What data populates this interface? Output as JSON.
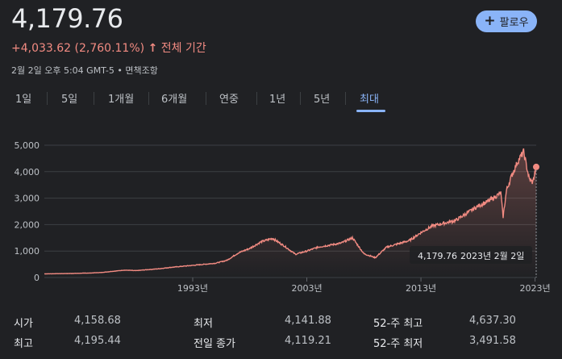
{
  "header": {
    "price": "4,179.76",
    "follow_label": "팔로우",
    "change_value": "+4,033.62 (2,760.11%)",
    "change_arrow": "↑",
    "change_period": "전체 기간",
    "timestamp": "2월 2일 오후 5:04 GMT-5 • 면책조항"
  },
  "tabs": [
    {
      "label": "1일"
    },
    {
      "label": "5일"
    },
    {
      "label": "1개월"
    },
    {
      "label": "6개월"
    },
    {
      "label": "연중"
    },
    {
      "label": "1년"
    },
    {
      "label": "5년"
    },
    {
      "label": "최대",
      "active": true
    }
  ],
  "colors": {
    "line": "#f28b82",
    "accent": "#8ab4f8",
    "background": "#202124"
  },
  "chart_data": {
    "type": "area",
    "y_ticks": [
      "5,000",
      "4,000",
      "3,000",
      "2,000",
      "1,000",
      "0"
    ],
    "x_ticks": [
      "1993년",
      "2003년",
      "2013년",
      "2023년"
    ],
    "ylim": [
      0,
      5000
    ],
    "xlim": [
      1980,
      2023.1
    ],
    "grid": true,
    "tooltip": {
      "value": "4,179.76",
      "date": "2023년 2월 2일"
    },
    "series": [
      {
        "x": [
          1980,
          1982,
          1984,
          1985,
          1987,
          1988,
          1990,
          1991,
          1993,
          1995,
          1996,
          1997,
          1998,
          1999,
          2000,
          2001,
          2002,
          2003,
          2004,
          2006,
          2007,
          2008,
          2009,
          2010,
          2012,
          2013,
          2014,
          2016,
          2018,
          2019,
          2020,
          2020.2,
          2020.5,
          2021,
          2021.5,
          2022,
          2022.5,
          2022.8,
          2023.1
        ],
        "y": [
          140,
          150,
          170,
          190,
          280,
          260,
          330,
          380,
          460,
          540,
          650,
          930,
          1100,
          1350,
          1480,
          1200,
          880,
          1000,
          1150,
          1300,
          1500,
          900,
          750,
          1150,
          1400,
          1700,
          1950,
          2150,
          2700,
          2900,
          3200,
          2300,
          3300,
          3900,
          4400,
          4750,
          3700,
          3600,
          4179.76
        ]
      }
    ]
  },
  "stats": [
    {
      "label": "시가",
      "value": "4,158.68"
    },
    {
      "label": "최고",
      "value": "4,195.44"
    },
    {
      "label": "최저",
      "value": "4,141.88"
    },
    {
      "label": "전일 종가",
      "value": "4,119.21"
    },
    {
      "label": "52-주 최고",
      "value": "4,637.30"
    },
    {
      "label": "52-주 최저",
      "value": "3,491.58"
    }
  ]
}
